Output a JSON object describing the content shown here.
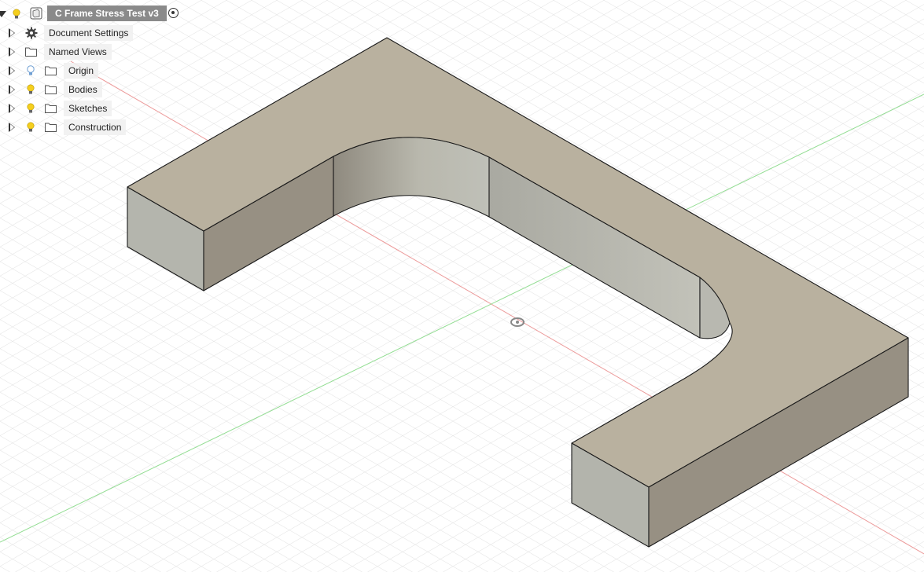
{
  "browser": {
    "root": {
      "title": "C Frame Stress Test v3",
      "icon": "component-icon",
      "visibility_icon": "lightbulb-icon",
      "activate_icon": "radio-icon"
    },
    "items": [
      {
        "label": "Document Settings",
        "icon": "gear-icon",
        "has_bulb": false
      },
      {
        "label": "Named Views",
        "icon": "folder-icon",
        "has_bulb": false
      },
      {
        "label": "Origin",
        "icon": "folder-icon",
        "has_bulb": true,
        "bulb_state": "off"
      },
      {
        "label": "Bodies",
        "icon": "folder-icon",
        "has_bulb": true,
        "bulb_state": "on"
      },
      {
        "label": "Sketches",
        "icon": "folder-icon",
        "has_bulb": true,
        "bulb_state": "on"
      },
      {
        "label": "Construction",
        "icon": "folder-icon",
        "has_bulb": true,
        "bulb_state": "on"
      }
    ]
  },
  "colors": {
    "top_face": "#b9b19f",
    "front_face": "#b3b4ac",
    "side_face": "#979083",
    "inner_face": "#a9a79d",
    "grid_line": "#dcdcdc",
    "x_axis": "#e8a0a0",
    "y_axis": "#9fe09f",
    "bulb_on": "#f5cf1e",
    "bulb_off": "#8fb7e0",
    "root_label_bg": "#8a8a8a"
  },
  "viewport": {
    "model": "c-frame-body",
    "pivot_icon": "orbit-pivot-icon"
  }
}
